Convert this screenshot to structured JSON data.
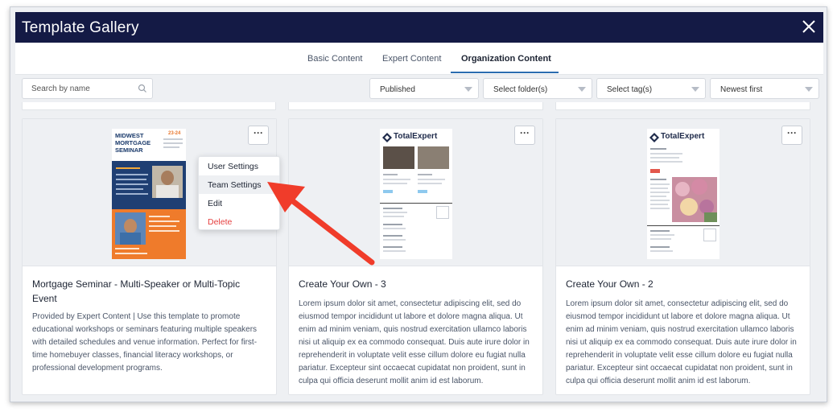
{
  "window": {
    "title": "Template Gallery",
    "close_icon": "close-icon"
  },
  "tabs": [
    {
      "label": "Basic Content",
      "active": false
    },
    {
      "label": "Expert Content",
      "active": false
    },
    {
      "label": "Organization Content",
      "active": true
    }
  ],
  "toolbar": {
    "search_placeholder": "Search by name",
    "status_filter": "Published",
    "folder_filter": "Select folder(s)",
    "tag_filter": "Select tag(s)",
    "sort": "Newest first"
  },
  "colors": {
    "header": "#141a45",
    "accent": "#2b6cb0",
    "danger": "#e53e3e",
    "arrow": "#f03c2a"
  },
  "context_menu": {
    "items": [
      {
        "label": "User Settings"
      },
      {
        "label": "Team Settings"
      },
      {
        "label": "Edit"
      },
      {
        "label": "Delete"
      }
    ]
  },
  "cards": [
    {
      "title": "Mortgage Seminar - Multi-Speaker or Multi-Topic Event",
      "description": "Provided by Expert Content | Use this template to promote educational workshops or seminars featuring multiple speakers with detailed schedules and venue information. Perfect for first-time homebuyer classes, financial literacy workshops, or professional development programs.",
      "more": "···",
      "thumb": {
        "heading": "MIDWEST MORTGAGE SEMINAR",
        "date": "23-24"
      }
    },
    {
      "title": "Create Your Own - 3",
      "description": "Lorem ipsum dolor sit amet, consectetur adipiscing elit, sed do eiusmod tempor incididunt ut labore et dolore magna aliqua. Ut enim ad minim veniam, quis nostrud exercitation ullamco laboris nisi ut aliquip ex ea commodo consequat. Duis aute irure dolor in reprehenderit in voluptate velit esse cillum dolore eu fugiat nulla pariatur. Excepteur sint occaecat cupidatat non proident, sunt in culpa qui officia deserunt mollit anim id est laborum.",
      "more": "···",
      "thumb": {
        "brand": "TotalExpert"
      }
    },
    {
      "title": "Create Your Own - 2",
      "description": "Lorem ipsum dolor sit amet, consectetur adipiscing elit, sed do eiusmod tempor incididunt ut labore et dolore magna aliqua. Ut enim ad minim veniam, quis nostrud exercitation ullamco laboris nisi ut aliquip ex ea commodo consequat. Duis aute irure dolor in reprehenderit in voluptate velit esse cillum dolore eu fugiat nulla pariatur. Excepteur sint occaecat cupidatat non proident, sunt in culpa qui officia deserunt mollit anim id est laborum.",
      "more": "···",
      "thumb": {
        "brand": "TotalExpert"
      }
    }
  ]
}
